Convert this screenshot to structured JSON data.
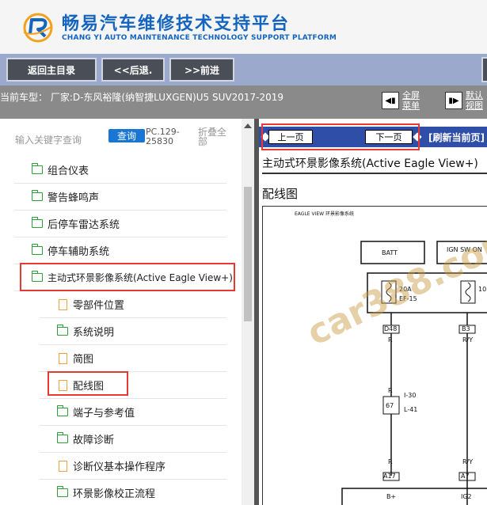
{
  "header": {
    "title_cn": "畅易汽车维修技术支持平台",
    "title_en": "CHANG YI AUTO MAINTENANCE TECHNOLOGY SUPPORT PLATFORM",
    "logo": "chang-yi-logo"
  },
  "toolbar": {
    "home_label": "返回主目录",
    "back_label": "<<后退.",
    "forward_label": ">>前进"
  },
  "vehicle": {
    "current_model": "当前车型： 厂家:D-东风裕隆(纳智捷LUXGEN)U5 SUV2017-2019",
    "fullscreen_label": "全屏菜单",
    "default_view_label": "默认视图"
  },
  "search": {
    "placeholder": "输入关键字查询",
    "query_label": "查询",
    "pc_code": "PC.129-25830",
    "collapse_all_label": "折叠全部"
  },
  "tree": {
    "items": [
      {
        "label": "组合仪表",
        "icon": "folder-icon"
      },
      {
        "label": "警告蜂鸣声",
        "icon": "folder-icon"
      },
      {
        "label": "后停车雷达系统",
        "icon": "folder-icon"
      },
      {
        "label": "停车辅助系统",
        "icon": "folder-icon"
      },
      {
        "label": "主动式环景影像系统(Active Eagle View+)",
        "icon": "folder-open-icon"
      },
      {
        "label": "零部件位置",
        "icon": "document-icon"
      },
      {
        "label": "系统说明",
        "icon": "folder-icon"
      },
      {
        "label": "简图",
        "icon": "document-icon"
      },
      {
        "label": "配线图",
        "icon": "document-icon"
      },
      {
        "label": "端子与参考值",
        "icon": "folder-icon"
      },
      {
        "label": "故障诊断",
        "icon": "folder-icon"
      },
      {
        "label": "诊断仪基本操作程序",
        "icon": "document-icon"
      },
      {
        "label": "环景影像校正流程",
        "icon": "folder-icon"
      }
    ]
  },
  "doc_nav": {
    "prev_label": "上一页",
    "next_label": "下一页",
    "refresh_label": "[刷新当前页]"
  },
  "document": {
    "title": "主动式环景影像系统(Active Eagle View+)",
    "section": "配线图",
    "diagram": {
      "caption": "EAGLE VIEW 环景影像系统",
      "batt": "BATT",
      "ign": "IGN SW ON",
      "fuse_left": "20A",
      "fuse_left_id": "EF-15",
      "fuse_right": "10",
      "conn_d48": "D48",
      "conn_b3": "B3",
      "wire_r": "R",
      "wire_ry": "R/Y",
      "conn_i30": "I-30",
      "conn_67": "67",
      "conn_l41": "L-41",
      "conn_a17": "A17",
      "conn_a7": "A7",
      "pin_bplus": "B+",
      "pin_ig2": "IG2",
      "watermark": "car388.com"
    }
  },
  "colors": {
    "brand_blue": "#1565c0",
    "toolbar_bg": "#9aa9cc",
    "vehicle_bar_bg": "#8a8a8a",
    "nav_strip_bg": "#2e4ea8",
    "highlight_red": "#e53935",
    "folder_green": "#2e9e3a",
    "doc_orange": "#f0a040"
  }
}
